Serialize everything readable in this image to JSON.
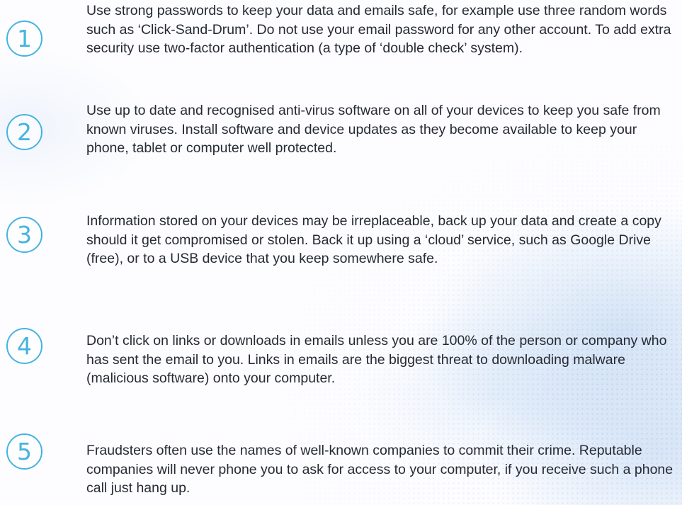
{
  "tips": [
    {
      "number": "1",
      "text": "Use strong passwords to keep your data and emails safe, for example use three random words such as ‘Click-Sand-Drum’.  Do not use your email password for any other account. To add extra security use two-factor authentication (a type of ‘double check’ system)."
    },
    {
      "number": "2",
      "text": "Use up to date and recognised anti-virus software on all of your devices to keep you safe from known viruses.  Install software and device updates as they become available to keep your phone, tablet or computer well protected."
    },
    {
      "number": "3",
      "text": "Information stored on your devices may be irreplaceable, back up your data and create a copy should it get compromised or stolen.  Back it up using a ‘cloud’ service, such as Google Drive (free), or to a USB device that you keep somewhere safe."
    },
    {
      "number": "4",
      "text": "Don’t click on links or downloads in emails unless you are 100% of the person or company who has sent the email to you.  Links in emails are the biggest threat to downloading malware (malicious software) onto your computer."
    },
    {
      "number": "5",
      "text": "Fraudsters often use the names of well-known companies to commit their crime.  Reputable companies will never phone you to ask for access to your computer, if you receive such a phone call just hang up."
    }
  ],
  "colors": {
    "accent": "#46b3e0",
    "text": "#262a33",
    "background": "#ffffff"
  }
}
